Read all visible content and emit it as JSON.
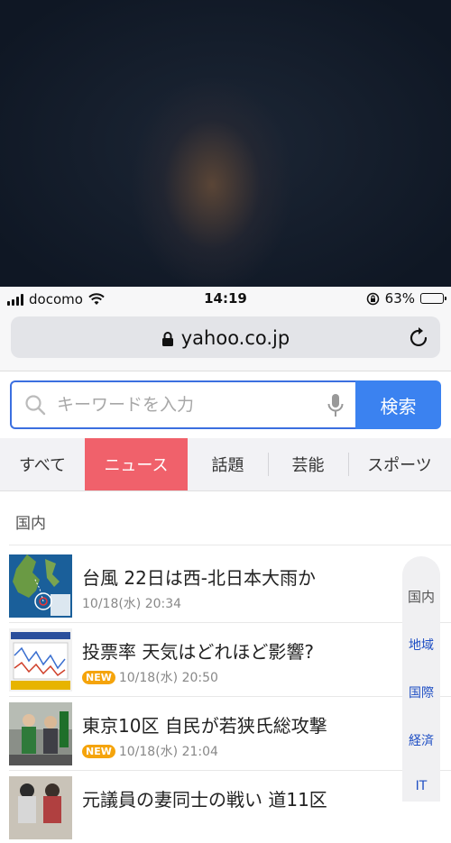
{
  "status": {
    "carrier": "docomo",
    "time": "14:19",
    "battery": "63%",
    "battery_level": 0.63
  },
  "address": {
    "url": "yahoo.co.jp"
  },
  "search": {
    "placeholder": "キーワードを入力",
    "button": "検索"
  },
  "tabs": [
    {
      "label": "すべて",
      "active": false
    },
    {
      "label": "ニュース",
      "active": true
    },
    {
      "label": "話題",
      "active": false
    },
    {
      "label": "芸能",
      "active": false
    },
    {
      "label": "スポーツ",
      "active": false
    }
  ],
  "section": {
    "title": "国内"
  },
  "news": [
    {
      "title": "台風 22日は西-北日本大雨か",
      "date": "10/18(水) 20:34",
      "new": false
    },
    {
      "title": "投票率 天気はどれほど影響?",
      "date": "10/18(水) 20:50",
      "new": true,
      "badge": "NEW"
    },
    {
      "title": "東京10区 自民が若狭氏総攻撃",
      "date": "10/18(水) 21:04",
      "new": true,
      "badge": "NEW"
    },
    {
      "title": "元議員の妻同士の戦い 道11区",
      "date": "",
      "new": false
    }
  ],
  "side_index": [
    "国内",
    "地域",
    "国際",
    "経済",
    "IT"
  ]
}
